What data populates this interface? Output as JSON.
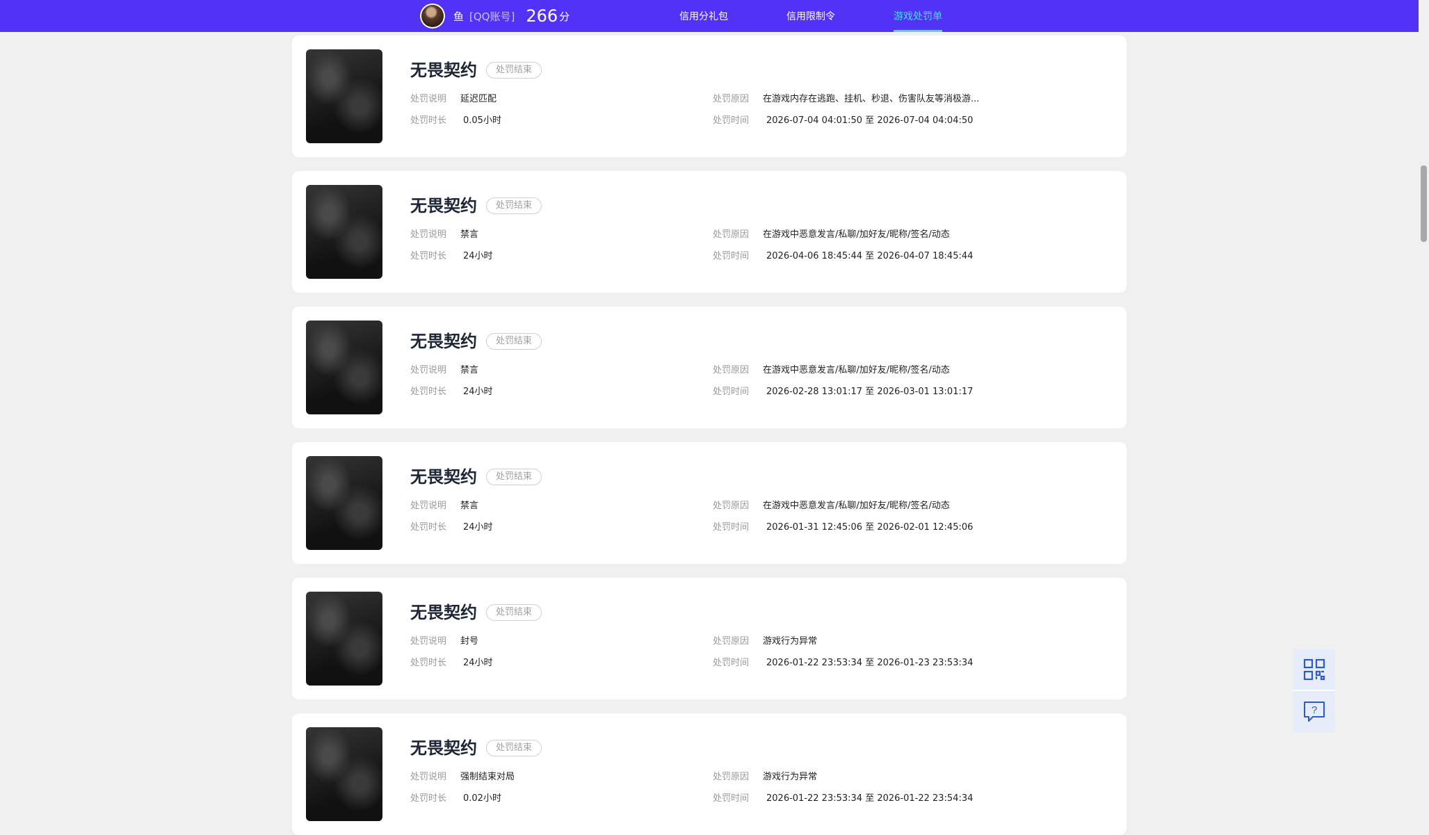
{
  "header": {
    "username": "鱼",
    "account_type": "[QQ账号]",
    "score": "266",
    "score_unit": "分",
    "tabs": [
      {
        "label": "信用分礼包"
      },
      {
        "label": "信用限制令"
      },
      {
        "label": "游戏处罚单"
      }
    ]
  },
  "labels": {
    "status": "处罚结束",
    "desc": "处罚说明",
    "duration": "处罚时长",
    "reason": "处罚原因",
    "time": "处罚时间"
  },
  "records": [
    {
      "game": "无畏契约",
      "desc": "延迟匹配",
      "duration": "0.05小时",
      "reason": "在游戏内存在逃跑、挂机、秒退、伤害队友等消极游...",
      "time": "2026-07-04 04:01:50 至 2026-07-04 04:04:50"
    },
    {
      "game": "无畏契约",
      "desc": "禁言",
      "duration": "24小时",
      "reason": "在游戏中恶意发言/私聊/加好友/昵称/签名/动态",
      "time": "2026-04-06 18:45:44 至 2026-04-07 18:45:44"
    },
    {
      "game": "无畏契约",
      "desc": "禁言",
      "duration": "24小时",
      "reason": "在游戏中恶意发言/私聊/加好友/昵称/签名/动态",
      "time": "2026-02-28 13:01:17 至 2026-03-01 13:01:17"
    },
    {
      "game": "无畏契约",
      "desc": "禁言",
      "duration": "24小时",
      "reason": "在游戏中恶意发言/私聊/加好友/昵称/签名/动态",
      "time": "2026-01-31 12:45:06 至 2026-02-01 12:45:06"
    },
    {
      "game": "无畏契约",
      "desc": "封号",
      "duration": "24小时",
      "reason": "游戏行为异常",
      "time": "2026-01-22 23:53:34 至 2026-01-23 23:53:34"
    },
    {
      "game": "无畏契约",
      "desc": "强制结束对局",
      "duration": "0.02小时",
      "reason": "游戏行为异常",
      "time": "2026-01-22 23:53:34 至 2026-01-22 23:54:34"
    }
  ],
  "float": {
    "qr_icon": "qr-code-icon",
    "help_icon": "help-chat-icon"
  }
}
